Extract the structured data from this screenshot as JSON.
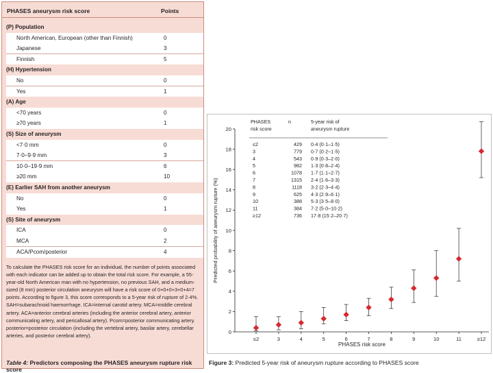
{
  "table": {
    "header": {
      "col1": "PHASES aneurysm risk score",
      "col2": "Points"
    },
    "sections": [
      {
        "title": "(P) Population",
        "items": [
          {
            "label": "North American, European (other than Finnish)",
            "points": "0"
          },
          {
            "label": "Japanese",
            "points": "3"
          },
          {
            "label": "Finnish",
            "points": "5"
          }
        ]
      },
      {
        "title": "(H) Hypertension",
        "items": [
          {
            "label": "No",
            "points": "0"
          },
          {
            "label": "Yes",
            "points": "1"
          }
        ]
      },
      {
        "title": "(A) Age",
        "items": [
          {
            "label": "<70 years",
            "points": "0"
          },
          {
            "label": "≥70 years",
            "points": "1"
          }
        ]
      },
      {
        "title": "(S) Size of aneurysm",
        "items": [
          {
            "label": "<7·0 mm",
            "points": "0"
          },
          {
            "label": "7·0–9·9 mm",
            "points": "3"
          },
          {
            "label": "10·0–19·9 mm",
            "points": "6"
          },
          {
            "label": "≥20 mm",
            "points": "10"
          }
        ]
      },
      {
        "title": "(E) Earlier SAH from another aneurysm",
        "items": [
          {
            "label": "No",
            "points": "0"
          },
          {
            "label": "Yes",
            "points": "1"
          }
        ]
      },
      {
        "title": "(S) Site of aneurysm",
        "items": [
          {
            "label": "ICA",
            "points": "0"
          },
          {
            "label": "MCA",
            "points": "2"
          },
          {
            "label": "ACA/Pcom/posterior",
            "points": "4"
          }
        ]
      }
    ],
    "note": "To calculate the PHASES risk score for an individual, the number of points associated with each indicator can be added up to obtain the total risk score. For example, a 55-year-old North American man with no hypertension, no previous SAH, and a medium-sized (8 mm) posterior circulation aneurysm will have a risk score of 0+0+0+3+0+4=7 points. According to figure 3, this score corresponds to a 5-year risk of rupture of 2·4%. SAH=subarachnoid haemorrhage. ICA=internal carotid artery. MCA=middle cerebral artery. ACA=anterior cerebral arteries (including the anterior cerebral artery, anterior communicating artery, and pericallosal artery). Pcom=posterior communicating artery. posterior=posterior circulation (including the vertebral artery, basilar artery, cerebellar arteries, and posterior cerebral artery).",
    "caption_label": "Table 4:",
    "caption_text": " Predictors composing the PHASES aneurysm rupture risk score"
  },
  "figure": {
    "caption_label": "Figure 3:",
    "caption_text": " Predicted 5-year risk of aneurysm rupture according to PHASES score"
  },
  "chart_data": {
    "type": "scatter",
    "title": "",
    "xlabel": "PHASES risk score",
    "ylabel": "Predicted probability of aneurysm rupture (%)",
    "ylim": [
      0,
      20
    ],
    "yticks": [
      "0",
      "2",
      "4",
      "6",
      "8",
      "10",
      "12",
      "14",
      "16",
      "18",
      "20"
    ],
    "categories": [
      "≤2",
      "3",
      "4",
      "5",
      "6",
      "7",
      "8",
      "9",
      "10",
      "11",
      "≥12"
    ],
    "values": [
      0.4,
      0.7,
      0.9,
      1.3,
      1.7,
      2.4,
      3.2,
      4.3,
      5.3,
      7.2,
      17.8
    ],
    "ci_low": [
      0.1,
      0.2,
      0.3,
      0.8,
      1.1,
      1.6,
      2.3,
      2.9,
      3.5,
      5.0,
      15.2
    ],
    "ci_high": [
      1.5,
      1.5,
      2.0,
      2.4,
      2.7,
      3.3,
      4.4,
      6.1,
      8.0,
      10.2,
      20.7
    ],
    "marker_color": "#d7282f",
    "inset_table": {
      "headers": [
        "PHASES\nrisk score",
        "n",
        "5-year risk of\naneurysm rupture"
      ],
      "rows": [
        [
          "≤2",
          "429",
          "0·4 (0·1–1·5)"
        ],
        [
          "3",
          "779",
          "0·7 (0·2–1·5)"
        ],
        [
          "4",
          "543",
          "0·9 (0·3–2·0)"
        ],
        [
          "5",
          "982",
          "1·3 (0·8–2·4)"
        ],
        [
          "6",
          "1078",
          "1·7 (1·1–2·7)"
        ],
        [
          "7",
          "1315",
          "2·4 (1·6–3·3)"
        ],
        [
          "8",
          "1118",
          "3·2 (2·3–4·4)"
        ],
        [
          "9",
          "625",
          "4·3 (2·9–6·1)"
        ],
        [
          "10",
          "388",
          "5·3 (3·5–8·0)"
        ],
        [
          "11",
          "384",
          "7·2 (5·0–10·2)"
        ],
        [
          "≥12",
          "736",
          "17·8 (15·2–20·7)"
        ]
      ]
    }
  }
}
